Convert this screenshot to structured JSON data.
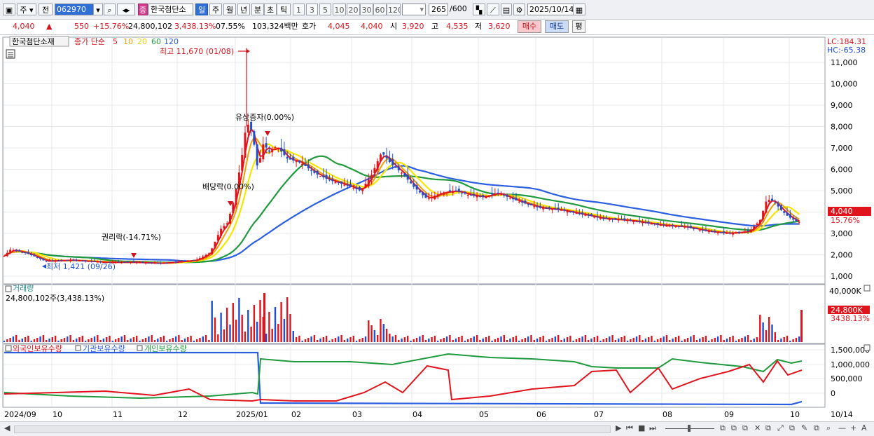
{
  "toolbar": {
    "market_label": "주",
    "prev_label": "전",
    "stock_code": "062970",
    "stock_badge": "증",
    "stock_name": "한국첨단소",
    "periods": [
      "일",
      "주",
      "월",
      "년",
      "분",
      "초",
      "틱"
    ],
    "active_period": "일",
    "intervals": [
      "1",
      "3",
      "5",
      "10",
      "20",
      "30",
      "60",
      "120"
    ],
    "count": "265",
    "count_total": "/600",
    "date": "2025/10/14"
  },
  "quote": {
    "price": "4,040",
    "change": "550",
    "change_pct": "+15.76%",
    "volume": "24,800,102",
    "volume_pct": "3,438.13%",
    "turnover_rate": "07.55%",
    "amount": "103,324백만",
    "ask_label": "호가",
    "ask1": "4,045",
    "ask2": "4,040",
    "open_label": "시",
    "open": "3,920",
    "high_label": "고",
    "high": "4,535",
    "low_label": "저",
    "low": "3,620",
    "buy_label": "매수",
    "sell_label": "매도",
    "eval_label": "평"
  },
  "price_panel": {
    "title": "한국첨단소재",
    "ma_label": "종가 단순",
    "ma_periods": [
      "5",
      "10",
      "20",
      "60",
      "120"
    ],
    "ma_colors": [
      "#e0141c",
      "#f0a000",
      "#f5e600",
      "#1f9a3c",
      "#2b5fe0"
    ],
    "lc_label": "LC:184.31",
    "hc_label": "HC:-65.38",
    "high_annotation": "최고 11,670 (01/08)",
    "low_annotation": "최저 1,421 (09/26)",
    "event_rights": "권리락(-14.71%)",
    "event_dividend": "배당락(0.00%)",
    "event_capital": "유상증자(0.00%)",
    "yaxis": [
      "11,000",
      "10,000",
      "9,000",
      "8,000",
      "7,000",
      "6,000",
      "5,000",
      "4,000",
      "3,000",
      "2,000",
      "1,000"
    ],
    "last_price_tag": "4,040",
    "last_pct_tag": "15.76%"
  },
  "volume_panel": {
    "title": "거래량",
    "value_label": "24,800,102주(3,438.13%)",
    "yaxis_top": "40,000K",
    "tag_value": "24,800K",
    "tag_pct": "3438.13%"
  },
  "holding_panel": {
    "legend": [
      "외국인보유수량",
      "기관보유수량",
      "개인보유수량"
    ],
    "legend_colors": [
      "#e0141c",
      "#2b5fe0",
      "#1f9a3c"
    ],
    "yaxis": [
      "1,500,000",
      "1,000,000",
      "500,000",
      "0"
    ]
  },
  "xaxis": {
    "labels": [
      "2024/09",
      "10",
      "11",
      "12",
      "2025/01",
      "02",
      "03",
      "04",
      "05",
      "06",
      "07",
      "08",
      "09",
      "10"
    ],
    "right_label": "10/14"
  }
}
